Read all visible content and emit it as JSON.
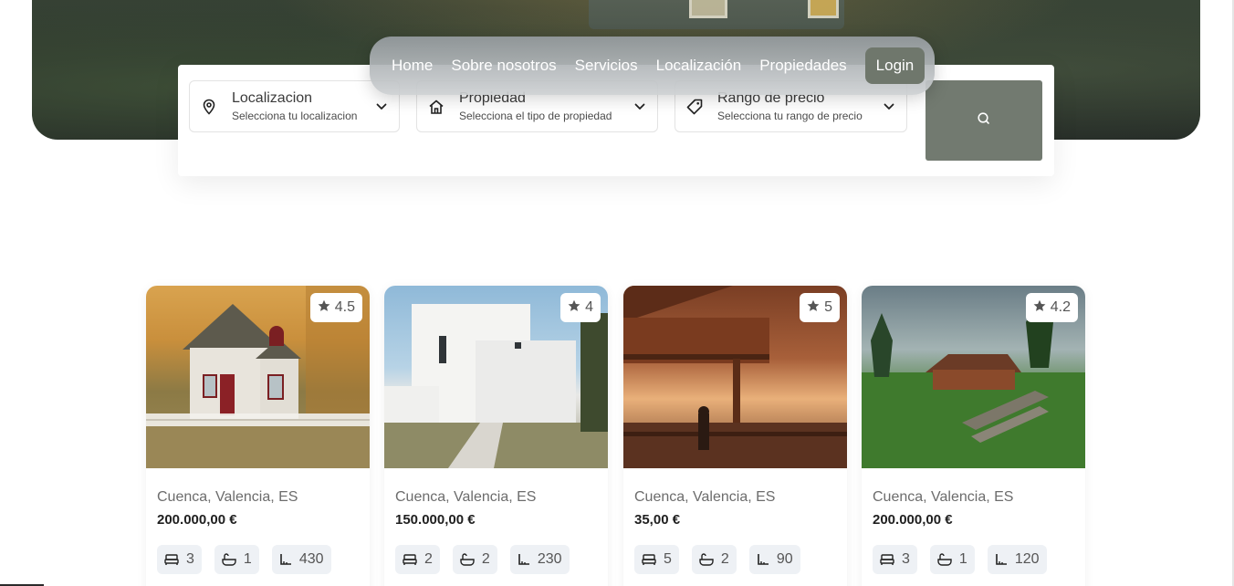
{
  "nav": {
    "items": [
      {
        "label": "Home"
      },
      {
        "label": "Sobre nosotros"
      },
      {
        "label": "Servicios"
      },
      {
        "label": "Localización"
      },
      {
        "label": "Propiedades"
      }
    ],
    "login_label": "Login"
  },
  "search": {
    "location": {
      "label": "Localizacion",
      "sub": "Selecciona tu localizacion",
      "icon": "map-pin-icon"
    },
    "property": {
      "label": "Propiedad",
      "sub": "Selecciona el tipo de propiedad",
      "icon": "house-icon"
    },
    "price": {
      "label": "Rango de precio",
      "sub": "Selecciona tu rango de precio",
      "icon": "tag-icon"
    },
    "button_icon": "search-icon"
  },
  "listings": [
    {
      "rating": "4.5",
      "location": "Cuenca, Valencia, ES",
      "price": "200.000,00 €",
      "beds": "3",
      "baths": "1",
      "area": "430"
    },
    {
      "rating": "4",
      "location": "Cuenca, Valencia, ES",
      "price": "150.000,00 €",
      "beds": "2",
      "baths": "2",
      "area": "230"
    },
    {
      "rating": "5",
      "location": "Cuenca, Valencia, ES",
      "price": "35,00 €",
      "beds": "5",
      "baths": "2",
      "area": "90"
    },
    {
      "rating": "4.2",
      "location": "Cuenca, Valencia, ES",
      "price": "200.000,00 €",
      "beds": "3",
      "baths": "1",
      "area": "120"
    }
  ],
  "colors": {
    "accent": "#727a70",
    "nav_login": "#6f776c"
  }
}
